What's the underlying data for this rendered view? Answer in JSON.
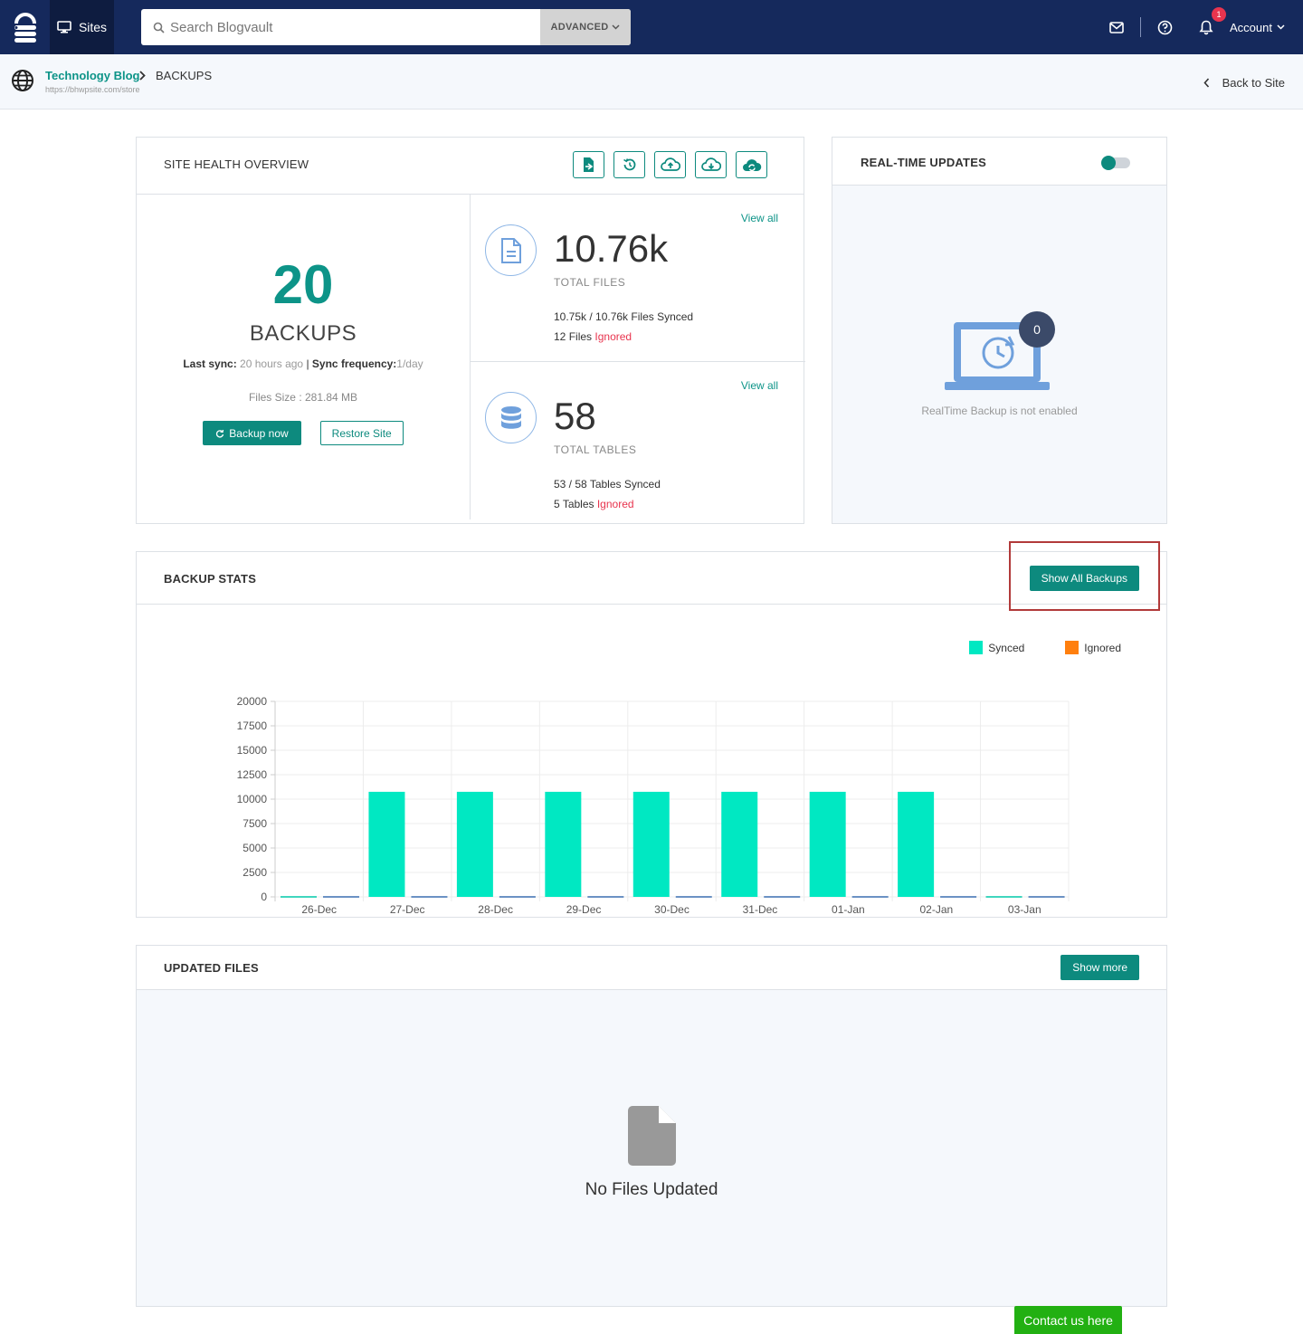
{
  "nav": {
    "sites_label": "Sites",
    "search_placeholder": "Search Blogvault",
    "advanced_label": "ADVANCED",
    "notification_count": "1",
    "account_label": "Account"
  },
  "breadcrumb": {
    "site_name": "Technology Blog",
    "page": "BACKUPS",
    "site_url": "https://bhwpsite.com/store",
    "back_label": "Back to Site"
  },
  "site_health": {
    "title": "SITE HEALTH OVERVIEW",
    "backups_count": "20",
    "backups_label": "BACKUPS",
    "last_sync_label": "Last sync:",
    "last_sync_value": "20 hours ago",
    "separator": "|",
    "sync_freq_label": "Sync frequency:",
    "sync_freq_value": "1/day",
    "files_size": "Files Size : 281.84 MB",
    "backup_now_label": "Backup now",
    "restore_label": "Restore Site",
    "files": {
      "view_all": "View all",
      "total": "10.76k",
      "caption": "TOTAL FILES",
      "synced_counts": "10.75k / 10.76k",
      "synced_word": "Files Synced",
      "ignored_count": "12",
      "ignored_noun": "Files",
      "ignored_word": "Ignored"
    },
    "tables": {
      "view_all": "View all",
      "total": "58",
      "caption": "TOTAL TABLES",
      "synced_counts": "53 / 58",
      "synced_word": "Tables Synced",
      "ignored_count": "5",
      "ignored_noun": "Tables",
      "ignored_word": "Ignored"
    }
  },
  "realtime": {
    "title": "REAL-TIME UPDATES",
    "badge": "0",
    "message": "RealTime Backup is not enabled"
  },
  "backup_stats": {
    "title": "BACKUP STATS",
    "show_all_label": "Show All Backups"
  },
  "chart_data": {
    "type": "bar",
    "categories": [
      "26-Dec",
      "27-Dec",
      "28-Dec",
      "29-Dec",
      "30-Dec",
      "31-Dec",
      "01-Jan",
      "02-Jan",
      "03-Jan"
    ],
    "series": [
      {
        "name": "Synced",
        "color": "#00e8c2",
        "values": [
          0,
          10750,
          10750,
          10750,
          10750,
          10750,
          10750,
          10750,
          0
        ]
      },
      {
        "name": "Ignored",
        "color": "#ff7f0e",
        "values": [
          0,
          0,
          0,
          0,
          0,
          0,
          0,
          0,
          0
        ]
      }
    ],
    "yticks": [
      0,
      2500,
      5000,
      7500,
      10000,
      12500,
      15000,
      17500,
      20000
    ],
    "ylim": [
      0,
      20000
    ],
    "legend_position": "top-right",
    "grid": true
  },
  "updated_files": {
    "title": "UPDATED FILES",
    "show_more_label": "Show more",
    "empty_message": "No Files Updated"
  },
  "contact_label": "Contact us here",
  "colors": {
    "nav_bg": "#15295c",
    "accent": "#0d8a7e",
    "ignored": "#e8344e",
    "synced_bar": "#00e8c2",
    "ignored_bar": "#ff7f0e"
  }
}
